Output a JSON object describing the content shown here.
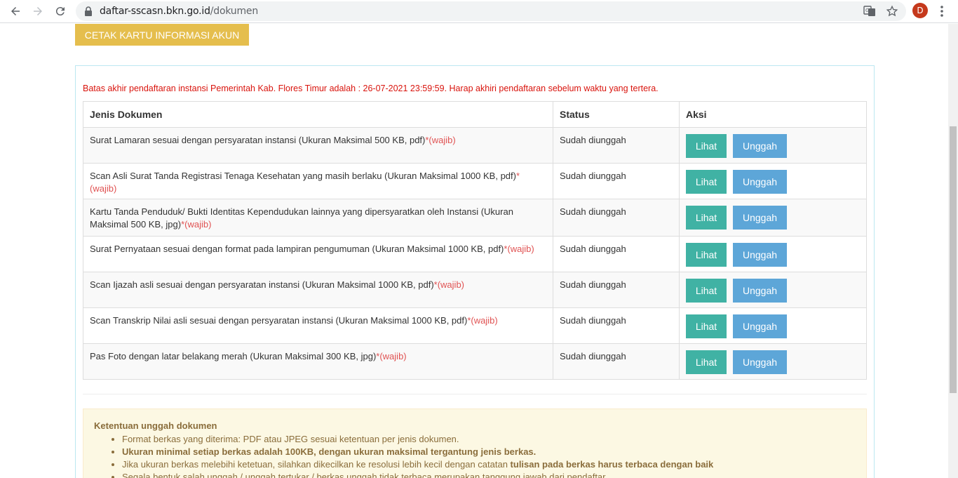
{
  "browser": {
    "url_host": "daftar-sscasn.bkn.go.id",
    "url_path": "/dokumen",
    "avatar_letter": "D"
  },
  "page": {
    "print_button_label": "CETAK KARTU INFORMASI AKUN",
    "deadline_text": "Batas akhir pendaftaran instansi Pemerintah Kab. Flores Timur adalah : 26-07-2021 23:59:59. Harap akhiri pendaftaran sebelum waktu yang tertera."
  },
  "table": {
    "headers": {
      "doc": "Jenis Dokumen",
      "status": "Status",
      "action": "Aksi"
    },
    "required_label": "*(wajib)",
    "view_label": "Lihat",
    "upload_label": "Unggah",
    "rows": [
      {
        "doc": "Surat Lamaran sesuai dengan persyaratan instansi (Ukuran Maksimal 500 KB, pdf)",
        "status": "Sudah diunggah"
      },
      {
        "doc": "Scan Asli Surat Tanda Registrasi Tenaga Kesehatan yang masih berlaku (Ukuran Maksimal 1000 KB, pdf)",
        "status": "Sudah diunggah"
      },
      {
        "doc": "Kartu Tanda Penduduk/ Bukti Identitas Kependudukan lainnya yang dipersyaratkan oleh Instansi (Ukuran Maksimal 500 KB, jpg)",
        "status": "Sudah diunggah"
      },
      {
        "doc": "Surat Pernyataan sesuai dengan format pada lampiran pengumuman (Ukuran Maksimal 1000 KB, pdf)",
        "status": "Sudah diunggah"
      },
      {
        "doc": "Scan Ijazah asli sesuai dengan persyaratan instansi (Ukuran Maksimal 1000 KB, pdf)",
        "status": "Sudah diunggah"
      },
      {
        "doc": "Scan Transkrip Nilai asli sesuai dengan persyaratan instansi (Ukuran Maksimal 1000 KB, pdf)",
        "status": "Sudah diunggah"
      },
      {
        "doc": "Pas Foto dengan latar belakang merah (Ukuran Maksimal 300 KB, jpg)",
        "status": "Sudah diunggah"
      }
    ]
  },
  "notice": {
    "title": "Ketentuan unggah dokumen",
    "item1": "Format berkas yang diterima: PDF atau JPEG sesuai ketentuan per jenis dokumen.",
    "item2": "Ukuran minimal setiap berkas adalah 100KB, dengan ukuran maksimal tergantung jenis berkas.",
    "item3_prefix": "Jika ukuran berkas melebihi ketetuan, silahkan dikecilkan ke resolusi lebih kecil dengan catatan ",
    "item3_bold": "tulisan pada berkas harus terbaca dengan baik",
    "item4": "Segala bentuk salah unggah / unggah tertukar / berkas unggah tidak terbaca merupakan tanggung jawab dari pendaftar"
  }
}
